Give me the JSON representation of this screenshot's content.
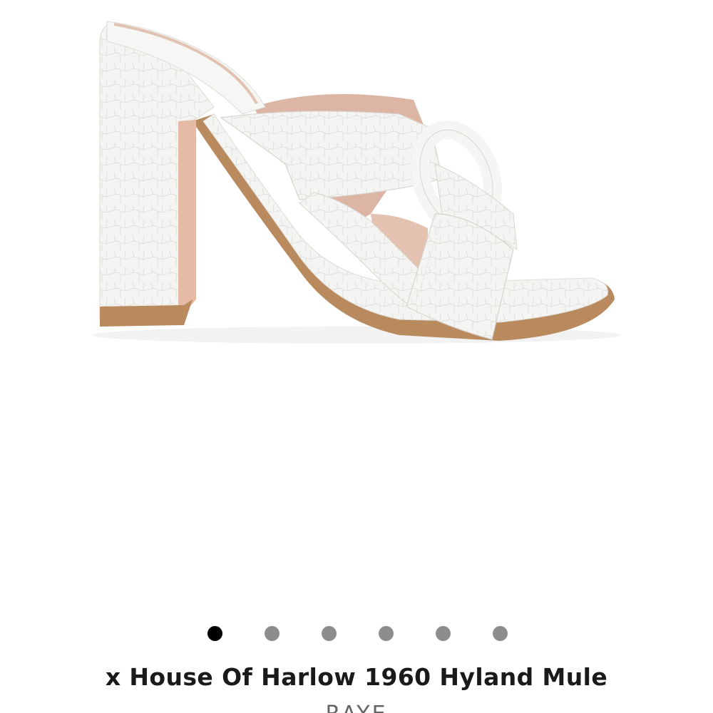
{
  "product": {
    "title": "x House Of Harlow 1960 Hyland Mule",
    "brand": "RAYE",
    "image_subject": "white croc-embossed block heel mule with knotted crossover straps"
  },
  "gallery": {
    "image_count": 6,
    "active_index": 0
  },
  "colors": {
    "shoe_white": "#f3f3f1",
    "lining_tan": "#dcb5a5",
    "sole_brown": "#b98a5e",
    "dot_active": "#000000",
    "dot_inactive": "#8c8c8c"
  }
}
